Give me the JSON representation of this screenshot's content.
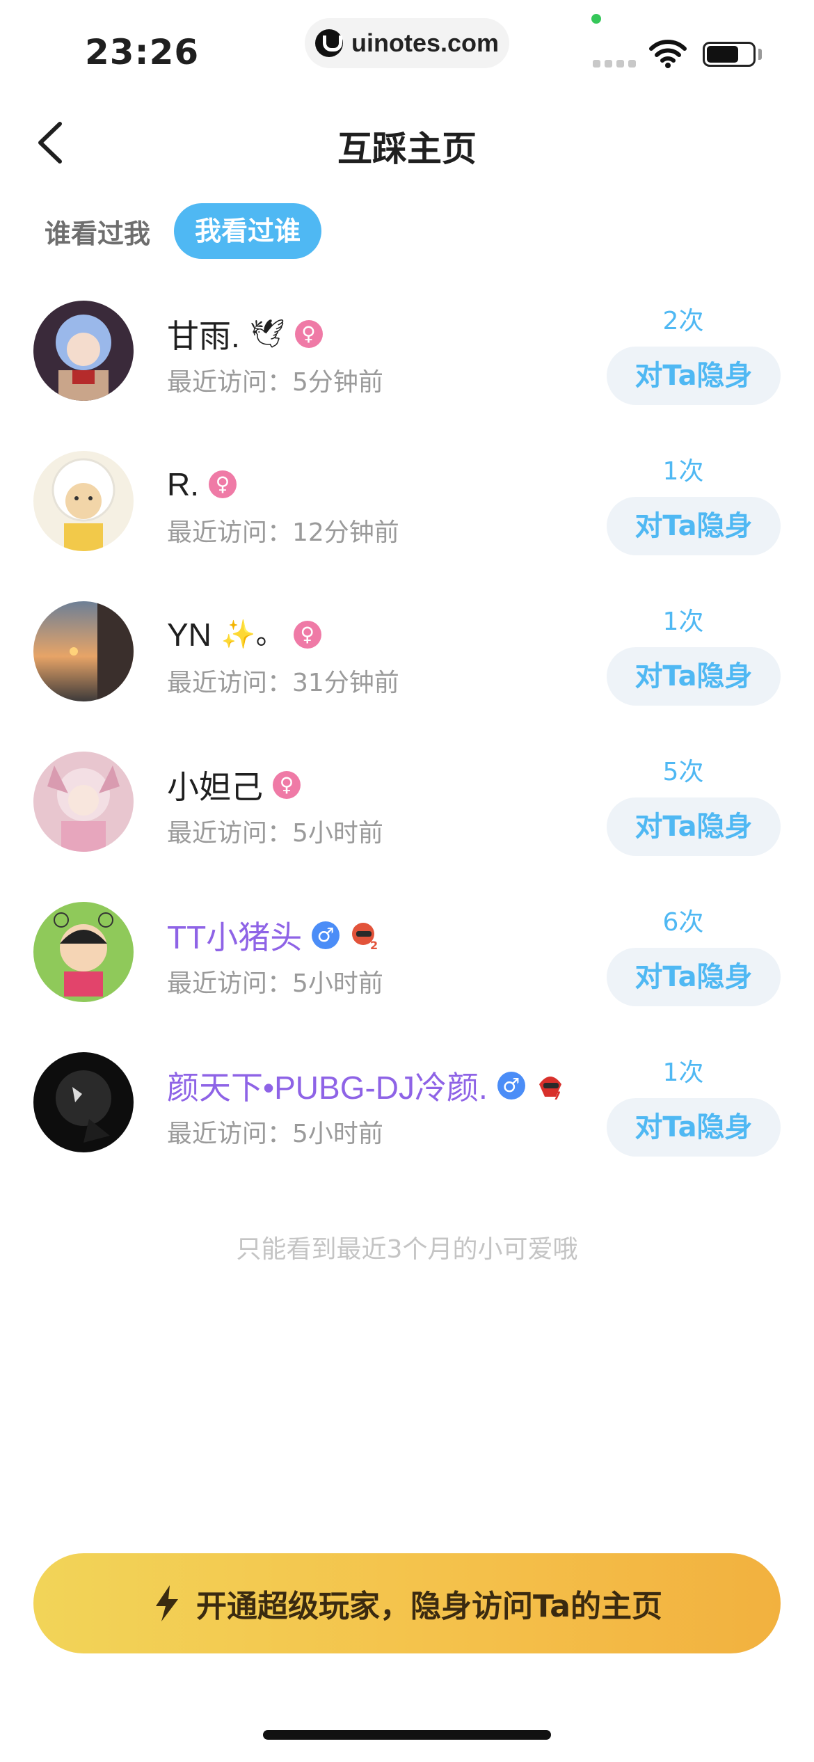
{
  "status_bar": {
    "time": "23:26",
    "url": "uinotes.com"
  },
  "header": {
    "title": "互踩主页"
  },
  "tabs": [
    {
      "label": "谁看过我",
      "active": false
    },
    {
      "label": "我看过谁",
      "active": true
    }
  ],
  "visitors": [
    {
      "name": "甘雨.",
      "emoji": "🕊",
      "gender": "female",
      "level_badge": false,
      "vip": false,
      "visit_time": "最近访问：5分钟前",
      "count": "2次",
      "action_label": "对Ta隐身"
    },
    {
      "name": "R.",
      "emoji": "",
      "gender": "female",
      "level_badge": false,
      "vip": false,
      "visit_time": "最近访问：12分钟前",
      "count": "1次",
      "action_label": "对Ta隐身"
    },
    {
      "name": "YN",
      "emoji": "✨。",
      "gender": "female",
      "level_badge": false,
      "vip": false,
      "visit_time": "最近访问：31分钟前",
      "count": "1次",
      "action_label": "对Ta隐身"
    },
    {
      "name": "小妲己",
      "emoji": "",
      "gender": "female",
      "level_badge": false,
      "vip": false,
      "visit_time": "最近访问：5小时前",
      "count": "5次",
      "action_label": "对Ta隐身"
    },
    {
      "name": "TT小猪头",
      "emoji": "",
      "gender": "male",
      "level_badge": true,
      "vip": true,
      "visit_time": "最近访问：5小时前",
      "count": "6次",
      "action_label": "对Ta隐身"
    },
    {
      "name": "颜天下•PUBG-DJ冷颜.",
      "emoji": "",
      "gender": "male",
      "level_badge": true,
      "vip": true,
      "visit_time": "最近访问：5小时前",
      "count": "1次",
      "action_label": "对Ta隐身"
    }
  ],
  "footer_note": "只能看到最近3个月的小可爱哦",
  "cta": {
    "label": "开通超级玩家，隐身访问Ta的主页",
    "icon": "lightning-icon"
  },
  "colors": {
    "accent": "#4fb8f3",
    "vip_name": "#8e63e6",
    "female": "#ef7aa6",
    "male": "#4b8df7",
    "cta_start": "#f2d458",
    "cta_end": "#f2b13f"
  }
}
